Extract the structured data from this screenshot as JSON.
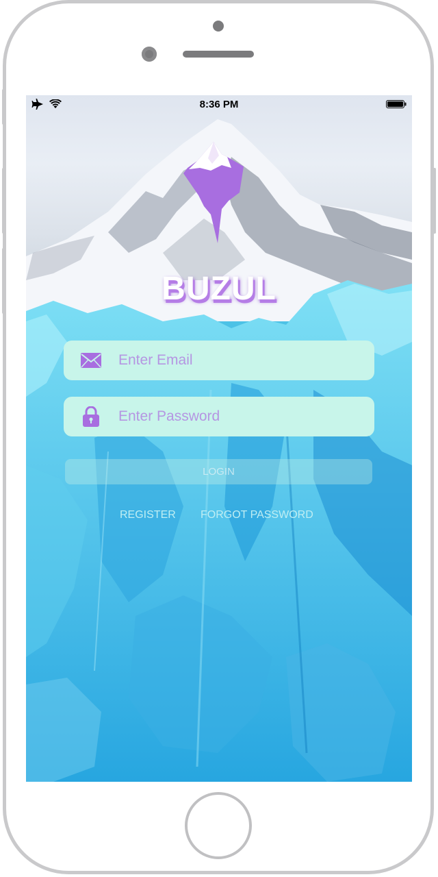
{
  "status_bar": {
    "time": "8:36 PM",
    "icons": [
      "airplane-icon",
      "wifi-icon",
      "battery-icon"
    ]
  },
  "brand": {
    "name": "BUZUL",
    "logo": "iceberg-logo",
    "logo_color": "#a86ee0"
  },
  "form": {
    "email": {
      "icon": "envelope-icon",
      "placeholder": "Enter Email",
      "value": ""
    },
    "password": {
      "icon": "lock-icon",
      "placeholder": "Enter Password",
      "value": ""
    },
    "login_label": "LOGIN"
  },
  "links": {
    "register": "REGISTER",
    "forgot_password": "FORGOT PASSWORD"
  },
  "colors": {
    "accent": "#a86ee0",
    "field_bg": "#c8f5ea",
    "link": "#bfeef3"
  }
}
